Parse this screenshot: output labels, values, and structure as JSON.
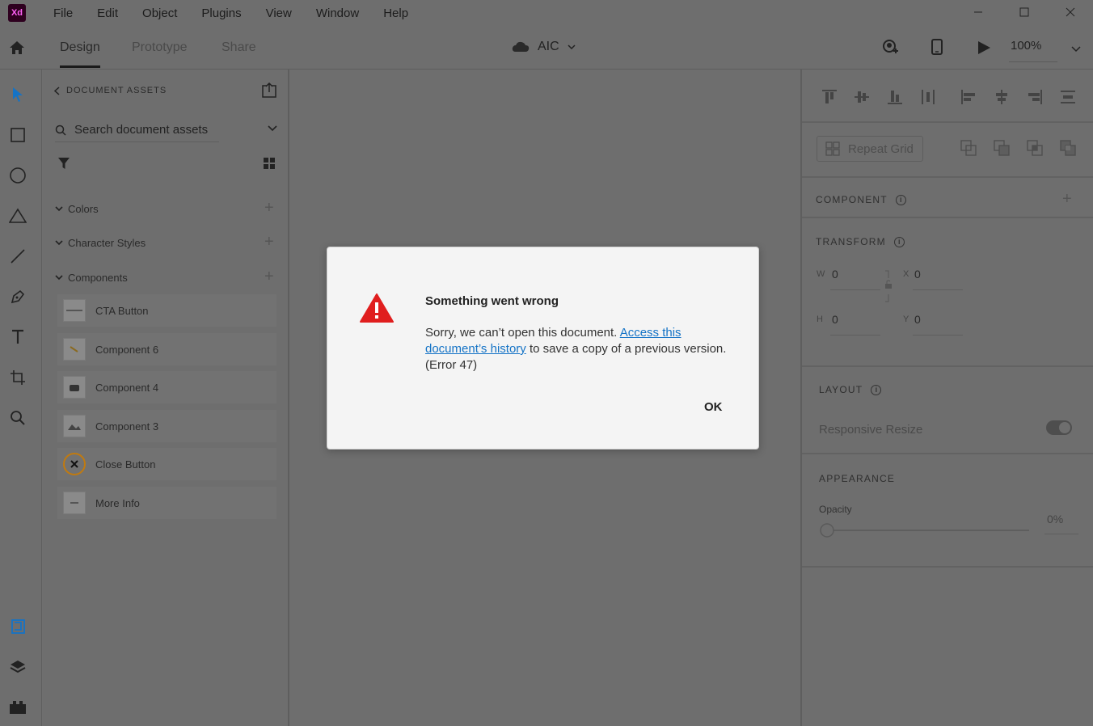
{
  "app": {
    "logo_text": "Xd",
    "brand_color": "#ff61f6"
  },
  "menu": [
    "File",
    "Edit",
    "Object",
    "Plugins",
    "View",
    "Window",
    "Help"
  ],
  "tabs": [
    "Design",
    "Prototype",
    "Share"
  ],
  "document": {
    "name": "AIC"
  },
  "zoom": "100%",
  "assets": {
    "header": "DOCUMENT ASSETS",
    "search_placeholder": "Search document assets",
    "sections": [
      "Colors",
      "Character Styles",
      "Components"
    ],
    "components": [
      "CTA Button",
      "Component 6",
      "Component 4",
      "Component 3",
      "Close Button",
      "More Info"
    ]
  },
  "right": {
    "repeat_grid": "Repeat Grid",
    "component": "COMPONENT",
    "transform": "TRANSFORM",
    "w_label": "W",
    "w_val": "0",
    "x_label": "X",
    "x_val": "0",
    "h_label": "H",
    "h_val": "0",
    "y_label": "Y",
    "y_val": "0",
    "layout": "LAYOUT",
    "responsive_resize": "Responsive Resize",
    "appearance": "APPEARANCE",
    "opacity_label": "Opacity",
    "opacity_val": "0%"
  },
  "dialog": {
    "title": "Something went wrong",
    "body_prefix": "Sorry, we can’t open this document. ",
    "link_text": "Access this document’s history",
    "body_suffix": " to save a copy of a previous version. (Error 47)",
    "ok_label": "OK",
    "icon_color": "#e01e1e",
    "link_color": "#1473c6"
  }
}
